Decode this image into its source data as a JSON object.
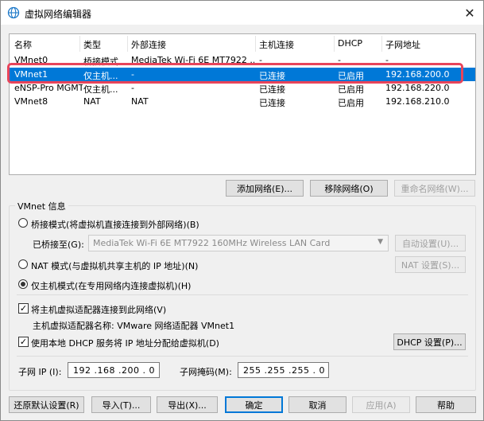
{
  "window": {
    "title": "虚拟网络编辑器",
    "close_glyph": "✕"
  },
  "table": {
    "headers": [
      "名称",
      "类型",
      "外部连接",
      "主机连接",
      "DHCP",
      "子网地址"
    ],
    "rows": [
      [
        "VMnet0",
        "桥接模式",
        "MediaTek Wi-Fi 6E MT7922 ...",
        "-",
        "-",
        "-"
      ],
      [
        "VMnet1",
        "仅主机...",
        "-",
        "已连接",
        "已启用",
        "192.168.200.0"
      ],
      [
        "eNSP-Pro MGMT",
        "仅主机...",
        "-",
        "已连接",
        "已启用",
        "192.168.220.0"
      ],
      [
        "VMnet8",
        "NAT",
        "NAT",
        "已连接",
        "已启用",
        "192.168.210.0"
      ]
    ],
    "selected_index": 1
  },
  "list_buttons": {
    "add": "添加网络(E)...",
    "remove": "移除网络(O)",
    "rename": "重命名网络(W)..."
  },
  "vmnet_info": {
    "title": "VMnet 信息",
    "bridged_mode": "桥接模式(将虚拟机直接连接到外部网络)(B)",
    "bridged_to_label": "已桥接至(G):",
    "bridged_to_value": "MediaTek Wi-Fi 6E MT7922 160MHz Wireless LAN Card",
    "auto_settings": "自动设置(U)...",
    "nat_mode": "NAT 模式(与虚拟机共享主机的 IP 地址)(N)",
    "nat_settings": "NAT 设置(S)...",
    "host_only_mode": "仅主机模式(在专用网络内连接虚拟机)(H)",
    "selected_mode": "host_only",
    "connect_adapter": "将主机虚拟适配器连接到此网络(V)",
    "connect_adapter_checked": true,
    "adapter_name": "主机虚拟适配器名称: VMware 网络适配器 VMnet1",
    "use_dhcp": "使用本地 DHCP 服务将 IP 地址分配给虚拟机(D)",
    "use_dhcp_checked": true,
    "dhcp_settings": "DHCP 设置(P)...",
    "subnet_ip_label": "子网 IP (I):",
    "subnet_ip": "192 .168 .200 . 0",
    "subnet_mask_label": "子网掩码(M):",
    "subnet_mask": "255 .255 .255 . 0"
  },
  "bottom_buttons": {
    "restore": "还原默认设置(R)",
    "import": "导入(T)...",
    "export": "导出(X)...",
    "ok": "确定",
    "cancel": "取消",
    "apply": "应用(A)",
    "help": "帮助"
  },
  "check_glyph": "✓",
  "colors": {
    "selection": "#0078d7",
    "highlight_outline": "#e8445a"
  }
}
